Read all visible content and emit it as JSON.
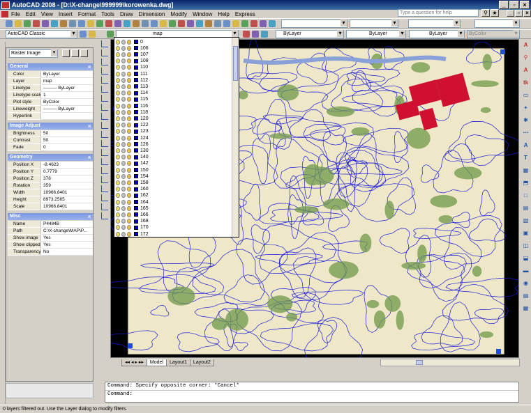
{
  "window": {
    "title": "AutoCAD 2008 - [D:\\X-change\\999999\\korowenka.dwg]"
  },
  "menu": [
    "File",
    "Edit",
    "View",
    "Insert",
    "Format",
    "Tools",
    "Draw",
    "Dimension",
    "Modify",
    "Window",
    "Help",
    "Express"
  ],
  "help": {
    "placeholder": "Type a question for help"
  },
  "toolbar2": {
    "workspace": "AutoCAD Classic",
    "layer": "map",
    "color": "ByLayer",
    "linetype": "ByLayer",
    "lineweight": "ByLayer",
    "plotstyle": "ByColor"
  },
  "properties": {
    "selection": "Raster Image",
    "sections": {
      "general": "General",
      "image_adjust": "Image Adjust",
      "geometry": "Geometry",
      "misc": "Misc"
    },
    "general": [
      {
        "k": "Color",
        "v": "ByLayer"
      },
      {
        "k": "Layer",
        "v": "map"
      },
      {
        "k": "Linetype",
        "v": "——— ByLayer"
      },
      {
        "k": "Linetype scale",
        "v": "1"
      },
      {
        "k": "Plot style",
        "v": "ByColor"
      },
      {
        "k": "Lineweight",
        "v": "——— ByLayer"
      },
      {
        "k": "Hyperlink",
        "v": ""
      }
    ],
    "image_adjust": [
      {
        "k": "Brightness",
        "v": "50"
      },
      {
        "k": "Contrast",
        "v": "50"
      },
      {
        "k": "Fade",
        "v": "0"
      }
    ],
    "geometry": [
      {
        "k": "Position X",
        "v": "-8.4623"
      },
      {
        "k": "Position Y",
        "v": "0.7779"
      },
      {
        "k": "Position Z",
        "v": "378"
      },
      {
        "k": "Rotation",
        "v": "359"
      },
      {
        "k": "Width",
        "v": "10966.8401"
      },
      {
        "k": "Height",
        "v": "8973.2565"
      },
      {
        "k": "Scale",
        "v": "10966.8401"
      }
    ],
    "misc": [
      {
        "k": "Name",
        "v": "P4484B"
      },
      {
        "k": "Path",
        "v": "C:\\X-change\\MAP\\P..."
      },
      {
        "k": "Show image",
        "v": "Yes"
      },
      {
        "k": "Show clipped",
        "v": "Yes"
      },
      {
        "k": "Transparency",
        "v": "No"
      }
    ]
  },
  "layers": [
    "0",
    "106",
    "107",
    "108",
    "110",
    "111",
    "112",
    "113",
    "114",
    "115",
    "116",
    "118",
    "120",
    "122",
    "123",
    "124",
    "126",
    "130",
    "140",
    "142",
    "150",
    "154",
    "158",
    "160",
    "162",
    "164",
    "165",
    "166",
    "168",
    "170",
    "172"
  ],
  "tabs": [
    "Model",
    "Layout1",
    "Layout2"
  ],
  "command": {
    "line1": "Command: Specify opposite corner: *Cancel*",
    "line2": "Command:"
  },
  "status": "0 layers filtered out.  Use the Layer dialog to modify filters."
}
